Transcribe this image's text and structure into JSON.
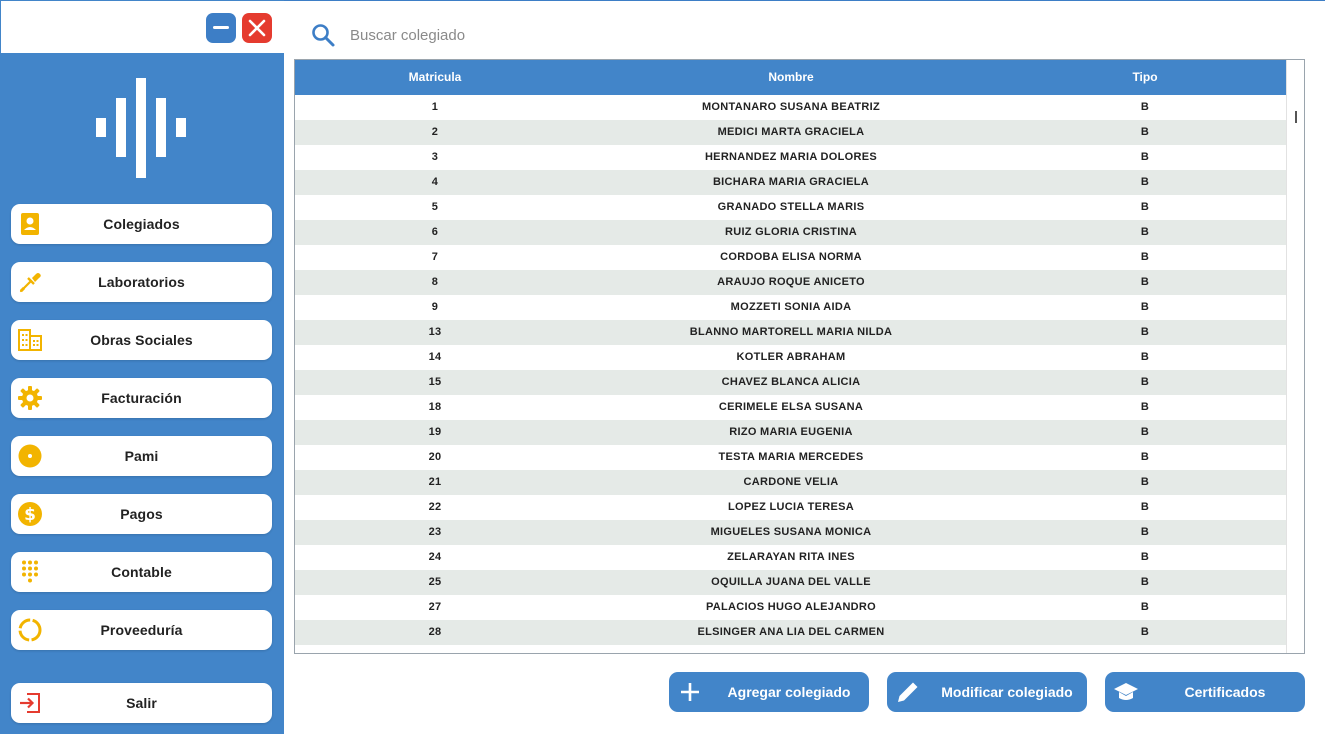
{
  "window": {
    "minimize_icon": "minimize-icon",
    "close_icon": "close-icon"
  },
  "colors": {
    "accent": "#4285c9",
    "icon_yellow": "#f2b400",
    "close_red": "#e53b2f",
    "row_alt": "#e5eae7"
  },
  "sidebar": {
    "items": [
      {
        "label": "Colegiados",
        "icon": "contact-card-icon"
      },
      {
        "label": "Laboratorios",
        "icon": "pipette-icon"
      },
      {
        "label": "Obras Sociales",
        "icon": "building-icon"
      },
      {
        "label": "Facturación",
        "icon": "gear-icon"
      },
      {
        "label": "Pami",
        "icon": "disc-icon"
      },
      {
        "label": "Pagos",
        "icon": "dollar-coin-icon"
      },
      {
        "label": "Contable",
        "icon": "dialpad-icon"
      },
      {
        "label": "Proveeduría",
        "icon": "ring-icon"
      }
    ],
    "exit": {
      "label": "Salir",
      "icon": "logout-icon"
    }
  },
  "search": {
    "placeholder": "Buscar colegiado",
    "value": ""
  },
  "table": {
    "columns": [
      "Matricula",
      "Nombre",
      "Tipo"
    ],
    "rows": [
      [
        "1",
        "MONTANARO SUSANA BEATRIZ",
        "B"
      ],
      [
        "2",
        "MEDICI MARTA GRACIELA",
        "B"
      ],
      [
        "3",
        "HERNANDEZ MARIA DOLORES",
        "B"
      ],
      [
        "4",
        "BICHARA MARIA GRACIELA",
        "B"
      ],
      [
        "5",
        "GRANADO STELLA MARIS",
        "B"
      ],
      [
        "6",
        "RUIZ GLORIA CRISTINA",
        "B"
      ],
      [
        "7",
        "CORDOBA ELISA NORMA",
        "B"
      ],
      [
        "8",
        "ARAUJO ROQUE ANICETO",
        "B"
      ],
      [
        "9",
        "MOZZETI SONIA AIDA",
        "B"
      ],
      [
        "13",
        "BLANNO MARTORELL MARIA NILDA",
        "B"
      ],
      [
        "14",
        "KOTLER ABRAHAM",
        "B"
      ],
      [
        "15",
        "CHAVEZ BLANCA ALICIA",
        "B"
      ],
      [
        "18",
        "CERIMELE ELSA SUSANA",
        "B"
      ],
      [
        "19",
        "RIZO MARIA EUGENIA",
        "B"
      ],
      [
        "20",
        "TESTA MARIA MERCEDES",
        "B"
      ],
      [
        "21",
        "CARDONE VELIA",
        "B"
      ],
      [
        "22",
        "LOPEZ LUCIA TERESA",
        "B"
      ],
      [
        "23",
        "MIGUELES SUSANA MONICA",
        "B"
      ],
      [
        "24",
        "ZELARAYAN RITA INES",
        "B"
      ],
      [
        "25",
        "OQUILLA JUANA DEL VALLE",
        "B"
      ],
      [
        "27",
        "PALACIOS HUGO ALEJANDRO",
        "B"
      ],
      [
        "28",
        "ELSINGER ANA LIA DEL CARMEN",
        "B"
      ]
    ]
  },
  "actions": {
    "add": {
      "label": "Agregar colegiado",
      "icon": "plus-icon"
    },
    "edit": {
      "label": "Modificar colegiado",
      "icon": "pencil-icon"
    },
    "certs": {
      "label": "Certificados",
      "icon": "graduation-cap-icon"
    }
  }
}
